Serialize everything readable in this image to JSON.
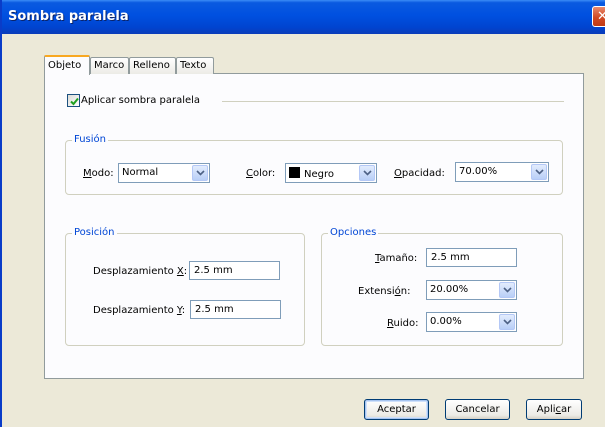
{
  "window": {
    "title": "Sombra paralela",
    "close_icon": "close-icon"
  },
  "tabs": [
    {
      "label": "Objeto",
      "active": true
    },
    {
      "label": "Marco",
      "active": false
    },
    {
      "label": "Relleno",
      "active": false
    },
    {
      "label": "Texto",
      "active": false
    }
  ],
  "apply_shadow": {
    "label": "Aplicar sombra paralela",
    "checked": true
  },
  "fusion": {
    "title": "Fusión",
    "mode_label_u": "M",
    "mode_label_rest": "odo:",
    "mode_value": "Normal",
    "color_label_u": "C",
    "color_label_rest": "olor:",
    "color_value": "Negro",
    "color_swatch": "#000000",
    "opacity_label_u": "O",
    "opacity_label_rest": "pacidad:",
    "opacity_value": "70.00%"
  },
  "position": {
    "title": "Posición",
    "offset_x_label_pre": "Desplazamiento ",
    "offset_x_label_u": "X",
    "offset_x_label_post": ":",
    "offset_x_value": "2.5 mm",
    "offset_y_label_pre": "Desplazamiento ",
    "offset_y_label_u": "Y",
    "offset_y_label_post": ":",
    "offset_y_value": "2.5 mm"
  },
  "options": {
    "title": "Opciones",
    "size_label_u": "T",
    "size_label_rest": "amaño:",
    "size_value": "2.5 mm",
    "spread_label_pre": "Extensi",
    "spread_label_u": "ó",
    "spread_label_post": "n:",
    "spread_value": "20.00%",
    "noise_label_u": "R",
    "noise_label_rest": "uido:",
    "noise_value": "0.00%"
  },
  "buttons": {
    "accept": "Aceptar",
    "cancel": "Cancelar",
    "apply_pre": "Apli",
    "apply_u": "c",
    "apply_post": "ar"
  }
}
